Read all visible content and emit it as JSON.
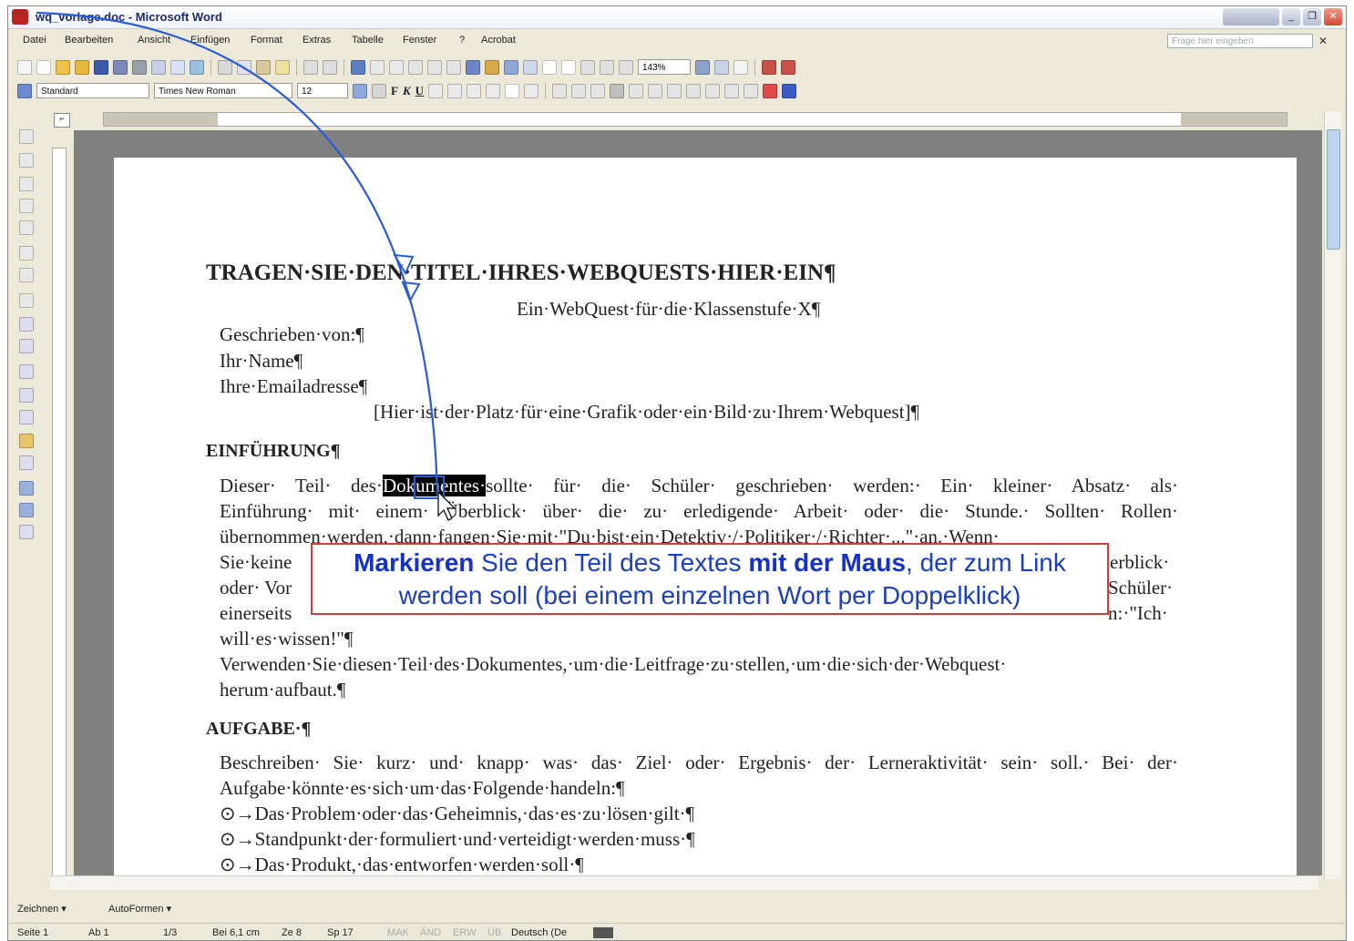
{
  "window": {
    "title": "wq_vorlage.doc - Microsoft Word"
  },
  "menu": {
    "items": [
      "Datei",
      "Bearbeiten",
      "Ansicht",
      "Einfügen",
      "Format",
      "Extras",
      "Tabelle",
      "Fenster",
      "?",
      "Acrobat"
    ],
    "help_placeholder": "Frage hier eingeben",
    "close_glyph": "✕"
  },
  "toolbar": {
    "zoom": "143%",
    "style": "Standard",
    "font": "Times New Roman",
    "size": "12",
    "bold": "F",
    "italic": "K",
    "underline": "U"
  },
  "drawing": {
    "draw_label": "Zeichnen ▾",
    "autoshapes_label": "AutoFormen ▾"
  },
  "status": {
    "page": "Seite 1",
    "section": "Ab 1",
    "pages": "1/3",
    "at": "Bei 6,1 cm",
    "line": "Ze 8",
    "col": "Sp 17",
    "mak": "MAK",
    "aend": "ÄND",
    "erw": "ERW",
    "ub": "ÜB",
    "lang": "Deutsch (De"
  },
  "document": {
    "title": "TRAGEN·SIE·DEN·TITEL·IHRES·WEBQUESTS·HIER·EIN¶",
    "subtitle": "Ein·WebQuest·für·die·Klassenstufe·X¶",
    "author_label": "Geschrieben·von:¶",
    "author_name": "Ihr·Name¶",
    "author_email": "Ihre·Emailadresse¶",
    "image_placeholder": "[Hier·ist·der·Platz·für·eine·Grafik·oder·ein·Bild·zu·Ihrem·Webquest]¶",
    "intro_heading": "EINFÜHRUNG¶",
    "intro_line1_pre": "Dieser· Teil· des·",
    "intro_line1_sel": "Dokumentes·",
    "intro_line1_post": "sollte· für· die· Schüler· geschrieben· werden:· Ein· kleiner· Absatz· als·",
    "intro_line2": "Einführung· mit· einem· Überblick· über· die· zu· erledigende· Arbeit· oder· die· Stunde.· Sollten· Rollen·",
    "intro_line3": "übernommen·werden,·dann·fangen·Sie·mit·\"Du·bist·ein·Detektiv·/·Politiker·/·Richter·...\"·an.·Wenn·",
    "intro_line4_pre": "Sie·keine",
    "intro_line4_post": "erblick·",
    "intro_line5_pre": "oder· Vor",
    "intro_line5_post": "Schüler·",
    "intro_line6_pre": "einerseits",
    "intro_line6_post": "n:·\"Ich·",
    "intro_line7": "will·es·wissen!\"¶",
    "intro_line8": "Verwenden·Sie·diesen·Teil·des·Dokumentes,·um·die·Leitfrage·zu·stellen,·um·die·sich·der·Webquest·",
    "intro_line9": "herum·aufbaut.¶",
    "task_heading": "AUFGABE·¶",
    "task_line1": "Beschreiben· Sie· kurz· und· knapp· was· das· Ziel· oder· Ergebnis· der· Lerneraktivität· sein· soll.· Bei· der·",
    "task_line2": "Aufgabe·könnte·es·sich·um·das·Folgende·handeln:¶",
    "bullet1": "⊙→Das·Problem·oder·das·Geheimnis,·das·es·zu·lösen·gilt·¶",
    "bullet2": "⊙→Standpunkt·der·formuliert·und·verteidigt·werden·muss·¶",
    "bullet3": "⊙→Das·Produkt,·das·entworfen·werden·soll·¶"
  },
  "callout": {
    "w1": "Markieren",
    "t1": " Sie den Teil des Textes ",
    "w2": "mit der Maus",
    "t2": ", der zum Link",
    "line2": "werden soll (bei einem einzelnen Wort per Doppelklick)"
  },
  "colors": {
    "callout_border": "#d43b3b",
    "callout_text": "#1b3fbf",
    "arrow": "#2a5bd7"
  }
}
